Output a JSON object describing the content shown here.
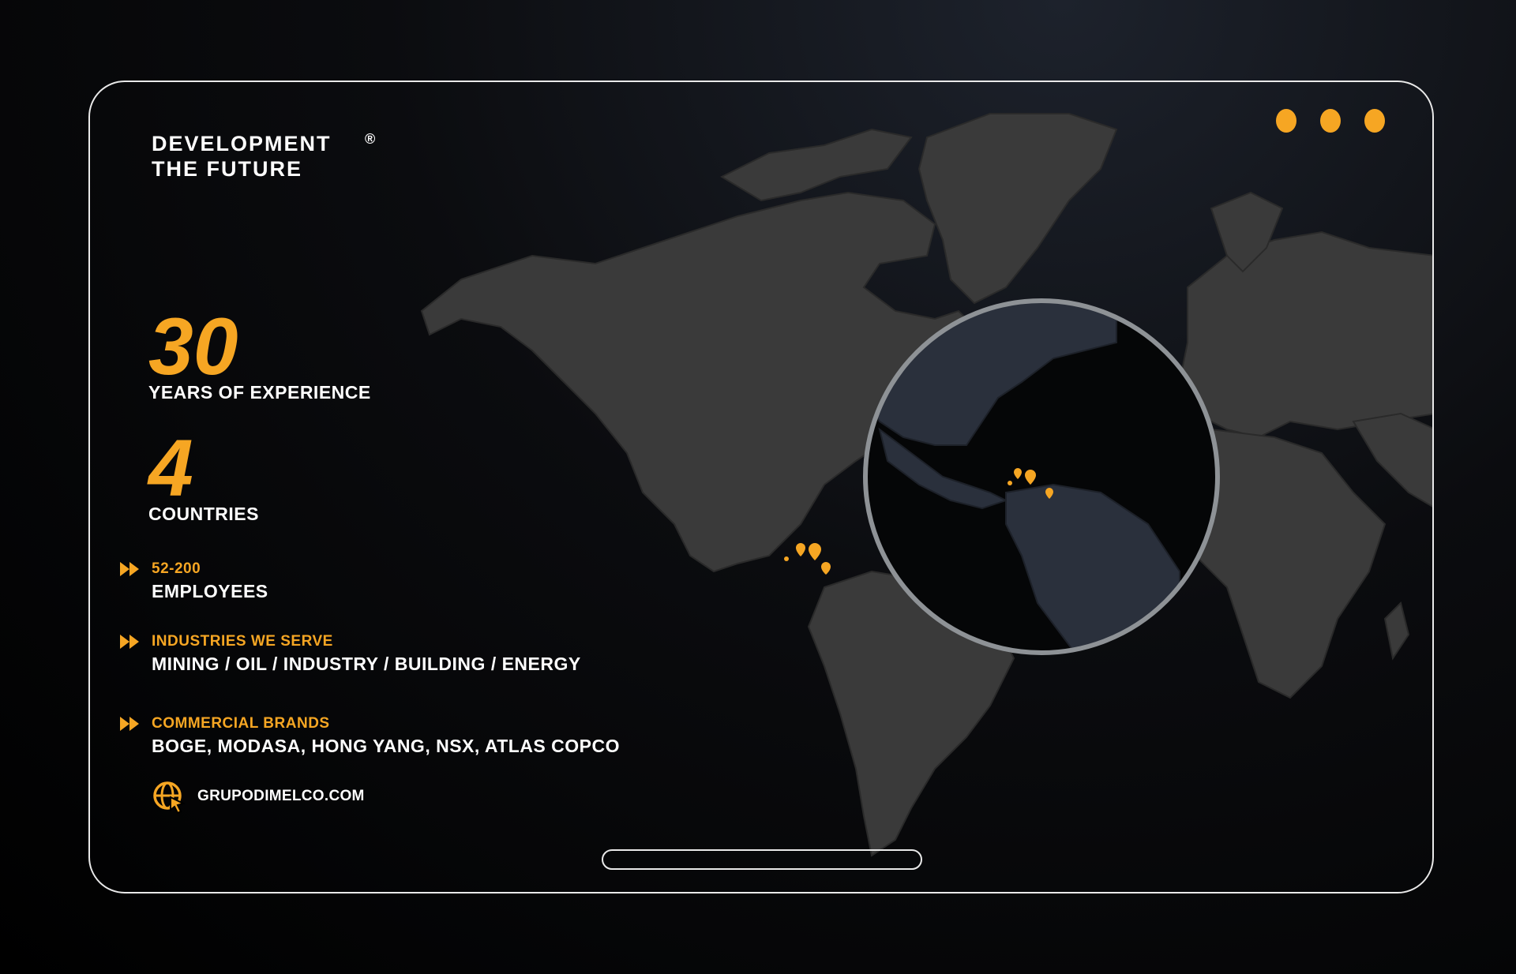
{
  "brand": {
    "line1": "DEVELOPMENT",
    "line2": "THE FUTURE",
    "reg": "®"
  },
  "stats": [
    {
      "value": "30",
      "label": "YEARS OF EXPERIENCE"
    },
    {
      "value": "4",
      "label": "COUNTRIES"
    }
  ],
  "items": [
    {
      "title": "52-200",
      "value": "EMPLOYEES"
    },
    {
      "title": "INDUSTRIES WE SERVE",
      "value": "MINING / OIL / INDUSTRY / BUILDING / ENERGY"
    },
    {
      "title": "COMMERCIAL BRANDS",
      "value": "BOGE, MODASA, HONG YANG, NSX, ATLAS COPCO"
    }
  ],
  "website": "GRUPODIMELCO.COM",
  "colors": {
    "accent": "#f6a623",
    "map": "#3a3a3a",
    "lens": "#2a303c",
    "frame": "#e9e9e9"
  },
  "icons": [
    "window-dot-icon",
    "double-chevron-icon",
    "globe-cursor-icon",
    "location-pin-icon"
  ]
}
